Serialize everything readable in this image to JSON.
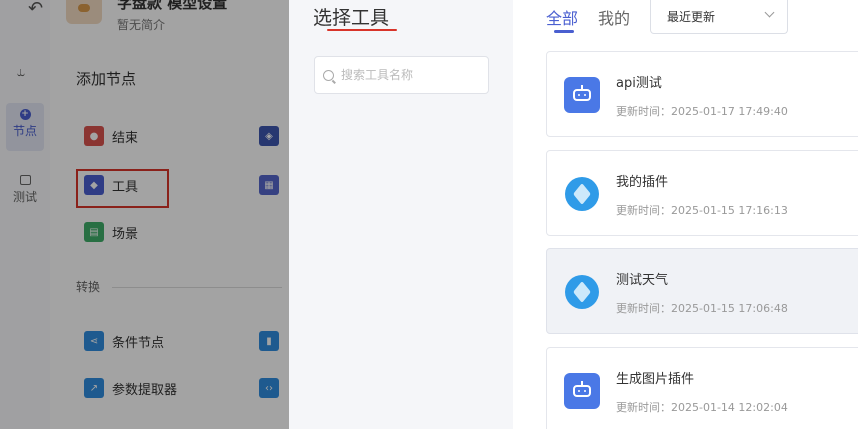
{
  "app": {
    "title": "字盘款 模型设置",
    "intro": "暂无简介"
  },
  "rail": {
    "nodes_label": "节点",
    "test_label": "测试"
  },
  "node_panel": {
    "title": "添加节点",
    "items": [
      {
        "label": "结束",
        "color": "#d9534f"
      },
      {
        "label": "工具",
        "color": "#4a5fd0"
      },
      {
        "label": "场景",
        "color": "#3fae6a"
      }
    ],
    "section": "转换",
    "convert_items": [
      {
        "label": "条件节点",
        "color": "#2f8ee0"
      },
      {
        "label": "参数提取器",
        "color": "#2f8ee0"
      }
    ]
  },
  "dialog": {
    "title": "选择工具",
    "search_placeholder": "搜索工具名称",
    "tabs": [
      "全部",
      "我的"
    ],
    "sort_value": "最近更新",
    "accent_color": "#4a5fd0",
    "highlight_color": "#d8342a",
    "tools": [
      {
        "name": "api测试",
        "updated": "更新时间：2025-01-17 17:49:40",
        "icon": "robot-icon"
      },
      {
        "name": "我的插件",
        "updated": "更新时间：2025-01-15 17:16:13",
        "icon": "cube-icon"
      },
      {
        "name": "测试天气",
        "updated": "更新时间：2025-01-15 17:06:48",
        "icon": "cube-icon"
      },
      {
        "name": "生成图片插件",
        "updated": "更新时间：2025-01-14 12:02:04",
        "icon": "robot-icon"
      }
    ]
  }
}
